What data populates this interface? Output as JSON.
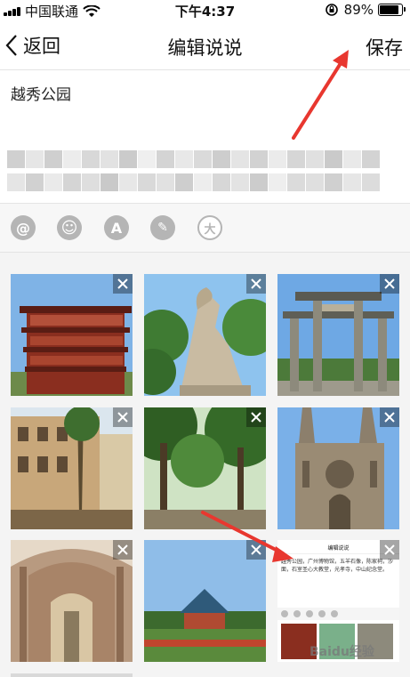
{
  "status_bar": {
    "carrier": "中国联通",
    "time": "下午4:37",
    "battery_text": "89%",
    "battery_level": 0.89,
    "icons": [
      "signal-icon",
      "wifi-icon",
      "rotation-lock-icon",
      "battery-icon"
    ]
  },
  "nav": {
    "back_label": "返回",
    "title": "编辑说说",
    "save_label": "保存"
  },
  "editor": {
    "text": "越秀公园"
  },
  "toolbar": {
    "items": [
      {
        "icon": "at-icon",
        "glyph": "@"
      },
      {
        "icon": "emoji-icon",
        "glyph": "☺"
      },
      {
        "icon": "font-icon",
        "glyph": "A"
      },
      {
        "icon": "magic-wand-icon",
        "glyph": "✎"
      },
      {
        "icon": "big-text-icon",
        "glyph": "大"
      }
    ]
  },
  "photos": [
    {
      "subject": "red-pagoda-tower"
    },
    {
      "subject": "five-goats-statue"
    },
    {
      "subject": "stone-archway"
    },
    {
      "subject": "colonial-building"
    },
    {
      "subject": "park-trees"
    },
    {
      "subject": "gothic-cathedral"
    },
    {
      "subject": "cathedral-interior"
    },
    {
      "subject": "memorial-hall"
    }
  ],
  "embedded_screenshot": {
    "nav_title": "编辑说说",
    "text": "越秀公园，广州博物馆，五羊石像，陈家祠，沙面，石室圣心大教堂，光孝寺，中山纪念堂。"
  },
  "watermark": "Baidu经验",
  "colors": {
    "accent_arrow": "#e8372f",
    "tool_icon_bg": "#b5b5b5"
  }
}
